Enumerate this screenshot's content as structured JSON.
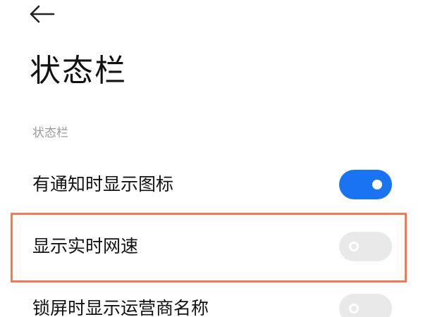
{
  "header": {
    "back_icon": "arrow-left-icon",
    "title": "状态栏"
  },
  "section": {
    "header": "状态栏"
  },
  "settings": [
    {
      "label": "有通知时显示图标",
      "enabled": true
    },
    {
      "label": "显示实时网速",
      "enabled": false
    },
    {
      "label": "锁屏时显示运营商名称",
      "enabled": false
    }
  ],
  "colors": {
    "accent": "#1a73f0",
    "toggle_off": "#e9e9e9",
    "highlight": "#f07b4e",
    "section_header": "#9a9a9a"
  }
}
